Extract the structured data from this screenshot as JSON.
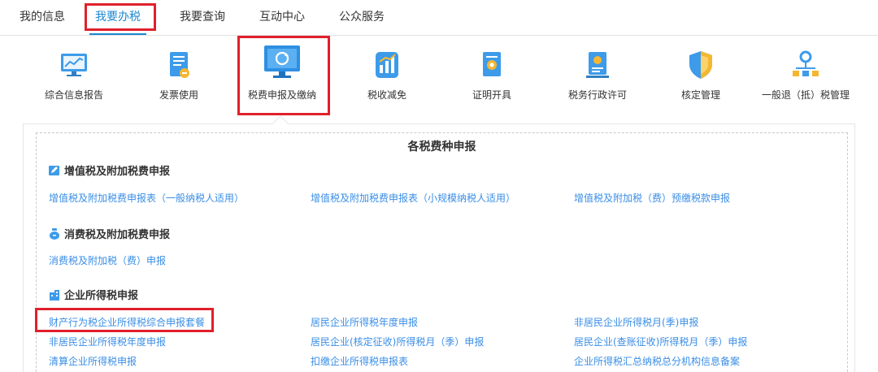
{
  "topnav": {
    "tabs": [
      {
        "label": "我的信息"
      },
      {
        "label": "我要办税"
      },
      {
        "label": "我要查询"
      },
      {
        "label": "互动中心"
      },
      {
        "label": "公众服务"
      }
    ]
  },
  "icons": [
    {
      "label": "综合信息报告",
      "icon": "chart-monitor-icon"
    },
    {
      "label": "发票使用",
      "icon": "invoice-document-icon"
    },
    {
      "label": "税费申报及缴纳",
      "icon": "monitor-refresh-icon"
    },
    {
      "label": "税收减免",
      "icon": "bar-chart-icon"
    },
    {
      "label": "证明开具",
      "icon": "certificate-icon"
    },
    {
      "label": "税务行政许可",
      "icon": "license-badge-icon"
    },
    {
      "label": "核定管理",
      "icon": "shield-icon"
    },
    {
      "label": "一般退（抵）税管理",
      "icon": "network-pin-icon"
    }
  ],
  "panel": {
    "title": "各税费种申报",
    "sections": [
      {
        "title": "增值税及附加税费申报",
        "links": [
          "增值税及附加税费申报表（一般纳税人适用）",
          "增值税及附加税费申报表（小规模纳税人适用）",
          "增值税及附加税（费）预缴税款申报"
        ]
      },
      {
        "title": "消费税及附加税费申报",
        "links": [
          "消费税及附加税（费）申报"
        ]
      },
      {
        "title": "企业所得税申报",
        "links": [
          "财产行为税企业所得税综合申报套餐",
          "居民企业所得税年度申报",
          "非居民企业所得税月(季)申报",
          "非居民企业所得税年度申报",
          "居民企业(核定征收)所得税月（季）申报",
          "居民企业(查账征收)所得税月（季）申报",
          "清算企业所得税申报",
          "扣缴企业所得税申报表",
          "企业所得税汇总纳税总分机构信息备案"
        ]
      }
    ]
  },
  "colors": {
    "accent": "#1e88d0",
    "link": "#3a8ee6",
    "highlight": "#e0202b"
  }
}
